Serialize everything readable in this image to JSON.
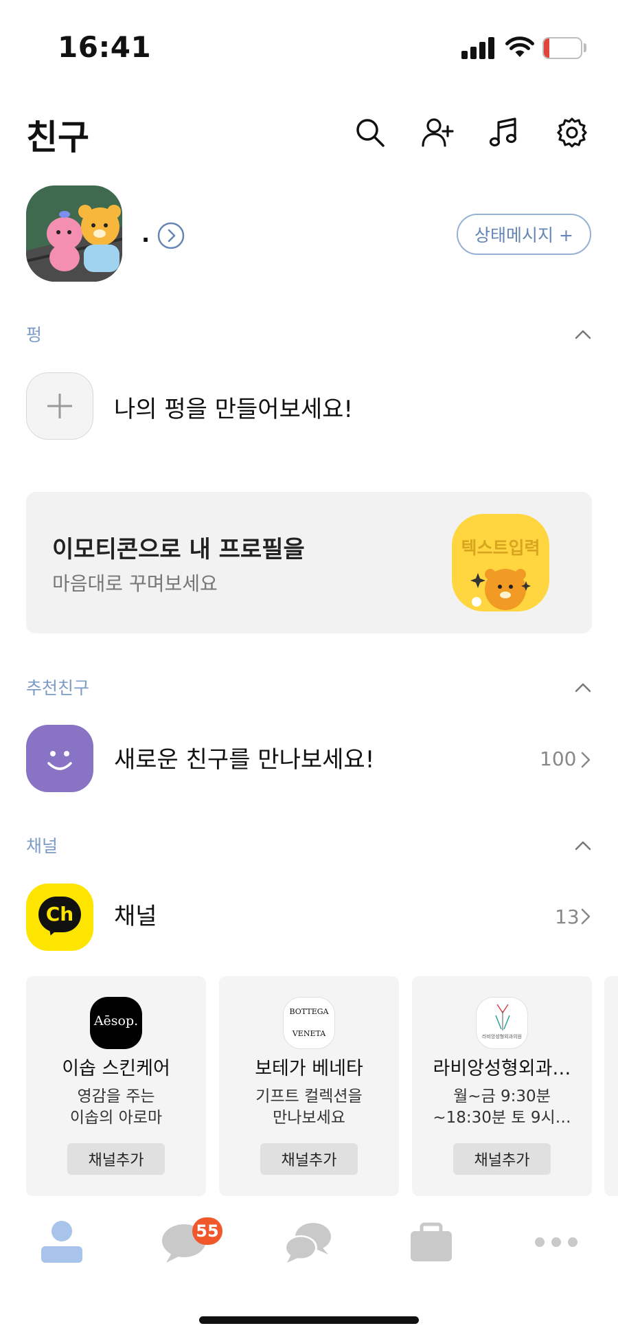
{
  "status_bar": {
    "time": "16:41",
    "battery": "11"
  },
  "header": {
    "title": "친구"
  },
  "profile": {
    "name": ".",
    "status_button": "상태메시지 +"
  },
  "sections": {
    "pung": {
      "label": "펑",
      "cta": "나의 펑을 만들어보세요!"
    },
    "promo": {
      "title": "이모티콘으로 내 프로필을",
      "subtitle": "마음대로 꾸며보세요",
      "image_text": "텍스트입력"
    },
    "recommend": {
      "label": "추천친구",
      "cta": "새로운 친구를 만나보세요!",
      "count": "100"
    },
    "channel": {
      "label": "채널",
      "title": "채널",
      "count": "13",
      "icon_text": "Ch"
    }
  },
  "channel_cards": [
    {
      "name": "이솝 스킨케어",
      "desc_line1": "영감을 주는",
      "desc_line2": "이솝의 아로마",
      "button": "채널추가",
      "logo_text": "Aēsop."
    },
    {
      "name": "보테가 베네타",
      "desc_line1": "기프트 컬렉션을",
      "desc_line2": "만나보세요",
      "button": "채널추가",
      "logo_line1": "BOTTEGA",
      "logo_line2": "VENETA"
    },
    {
      "name": "라비앙성형외과…",
      "desc_line1": "월~금 9:30분",
      "desc_line2": "~18:30분 토 9시…",
      "button": "채널추가",
      "logo_text": "라비앙성형외과의원"
    }
  ],
  "tab_bar": {
    "chat_badge": "55"
  },
  "colors": {
    "accent_blue": "#7c9cc6",
    "badge": "#f0582c",
    "channel_yellow": "#fee500",
    "friend_purple": "#8873c4",
    "promo_yellow": "#ffd640"
  }
}
